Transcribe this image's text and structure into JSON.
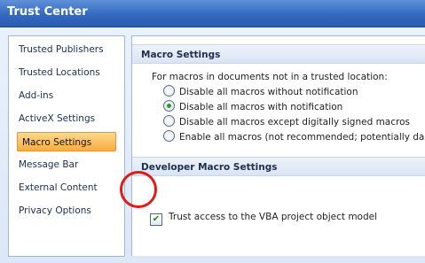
{
  "window": {
    "title": "Trust Center"
  },
  "sidebar": {
    "items": [
      {
        "label": "Trusted Publishers"
      },
      {
        "label": "Trusted Locations"
      },
      {
        "label": "Add-ins"
      },
      {
        "label": "ActiveX Settings"
      },
      {
        "label": "Macro Settings",
        "selected": true
      },
      {
        "label": "Message Bar"
      },
      {
        "label": "External Content"
      },
      {
        "label": "Privacy Options"
      }
    ]
  },
  "macro_settings": {
    "header": "Macro Settings",
    "caption": "For macros in documents not in a trusted location:",
    "options": [
      {
        "label": "Disable all macros without notification",
        "checked": false
      },
      {
        "label": "Disable all macros with notification",
        "checked": true
      },
      {
        "label": "Disable all macros except digitally signed macros",
        "checked": false
      },
      {
        "label": "Enable all macros (not recommended; potentially danger",
        "checked": false
      }
    ]
  },
  "developer_settings": {
    "header": "Developer Macro Settings",
    "trust_vba": {
      "label": "Trust access to the VBA project object model",
      "checked": true,
      "check_glyph": "✔"
    }
  },
  "colors": {
    "title_bar": "#3469c0",
    "selected_item": "#f6ac41",
    "annotation_circle": "#e11a1a"
  }
}
